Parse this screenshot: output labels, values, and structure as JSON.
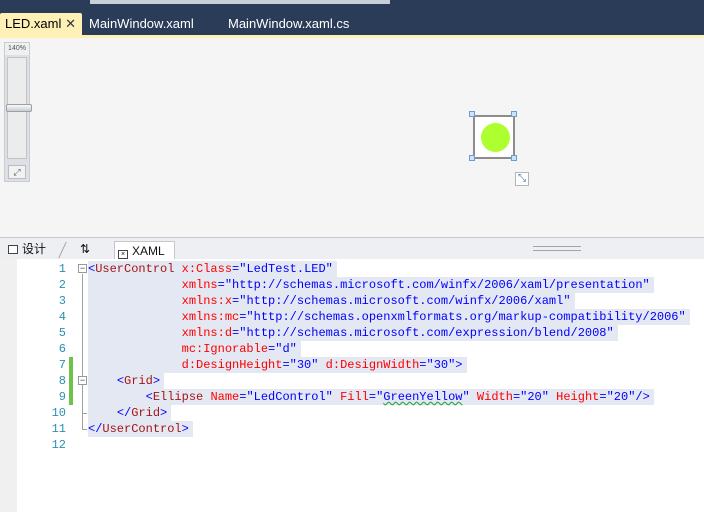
{
  "tabs": {
    "active": {
      "label": "LED.xaml",
      "close": "✕"
    },
    "others": [
      "MainWindow.xaml",
      "MainWindow.xaml.cs"
    ]
  },
  "designer": {
    "zoom_label": "140%",
    "zoom_level": 0.5,
    "ellipse_fill": "#ADFF2F",
    "fit_glyph": "⤢",
    "resize_glyph": "⤡"
  },
  "view_tabs": {
    "design": "设计",
    "swap": "⇅",
    "xaml": "XAML"
  },
  "editor": {
    "lines": [
      {
        "n": "1",
        "t": [
          [
            "p",
            "<"
          ],
          [
            "g",
            "UserControl"
          ],
          [
            "s",
            " "
          ],
          [
            "a",
            "x:Class"
          ],
          [
            "p",
            "=\""
          ],
          [
            "v",
            "LedTest.LED"
          ],
          [
            "p",
            "\""
          ]
        ]
      },
      {
        "n": "2",
        "t": [
          [
            "s",
            "             "
          ],
          [
            "a",
            "xmlns"
          ],
          [
            "p",
            "=\""
          ],
          [
            "v",
            "http://schemas.microsoft.com/winfx/2006/xaml/presentation"
          ],
          [
            "p",
            "\""
          ]
        ]
      },
      {
        "n": "3",
        "t": [
          [
            "s",
            "             "
          ],
          [
            "a",
            "xmlns:x"
          ],
          [
            "p",
            "=\""
          ],
          [
            "v",
            "http://schemas.microsoft.com/winfx/2006/xaml"
          ],
          [
            "p",
            "\""
          ]
        ]
      },
      {
        "n": "4",
        "t": [
          [
            "s",
            "             "
          ],
          [
            "a",
            "xmlns:mc"
          ],
          [
            "p",
            "=\""
          ],
          [
            "v",
            "http://schemas.openxmlformats.org/markup-compatibility/2006"
          ],
          [
            "p",
            "\""
          ]
        ]
      },
      {
        "n": "5",
        "t": [
          [
            "s",
            "             "
          ],
          [
            "a",
            "xmlns:d"
          ],
          [
            "p",
            "=\""
          ],
          [
            "v",
            "http://schemas.microsoft.com/expression/blend/2008"
          ],
          [
            "p",
            "\""
          ]
        ]
      },
      {
        "n": "6",
        "t": [
          [
            "s",
            "             "
          ],
          [
            "a",
            "mc:Ignorable"
          ],
          [
            "p",
            "=\""
          ],
          [
            "v",
            "d"
          ],
          [
            "p",
            "\""
          ]
        ]
      },
      {
        "n": "7",
        "t": [
          [
            "s",
            "             "
          ],
          [
            "a",
            "d:DesignHeight"
          ],
          [
            "p",
            "=\""
          ],
          [
            "v",
            "30"
          ],
          [
            "p",
            "\""
          ],
          [
            "s",
            " "
          ],
          [
            "a",
            "d:DesignWidth"
          ],
          [
            "p",
            "=\""
          ],
          [
            "v",
            "30"
          ],
          [
            "p",
            "\">"
          ]
        ]
      },
      {
        "n": "8",
        "t": [
          [
            "s",
            "    "
          ],
          [
            "p",
            "<"
          ],
          [
            "g",
            "Grid"
          ],
          [
            "p",
            ">"
          ]
        ]
      },
      {
        "n": "9",
        "t": [
          [
            "s",
            "        "
          ],
          [
            "p",
            "<"
          ],
          [
            "g",
            "Ellipse"
          ],
          [
            "s",
            " "
          ],
          [
            "a",
            "Name"
          ],
          [
            "p",
            "=\""
          ],
          [
            "v",
            "LedControl"
          ],
          [
            "p",
            "\""
          ],
          [
            "s",
            " "
          ],
          [
            "a",
            "Fill"
          ],
          [
            "p",
            "=\""
          ],
          [
            "w",
            "GreenYellow"
          ],
          [
            "p",
            "\""
          ],
          [
            "s",
            " "
          ],
          [
            "a",
            "Width"
          ],
          [
            "p",
            "=\""
          ],
          [
            "v",
            "20"
          ],
          [
            "p",
            "\""
          ],
          [
            "s",
            " "
          ],
          [
            "a",
            "Height"
          ],
          [
            "p",
            "=\""
          ],
          [
            "v",
            "20"
          ],
          [
            "p",
            "\"/>"
          ]
        ]
      },
      {
        "n": "10",
        "t": [
          [
            "s",
            "    "
          ],
          [
            "p",
            "</"
          ],
          [
            "g",
            "Grid"
          ],
          [
            "p",
            ">"
          ]
        ]
      },
      {
        "n": "11",
        "t": [
          [
            "p",
            "</"
          ],
          [
            "g",
            "UserControl"
          ],
          [
            "p",
            ">"
          ]
        ]
      },
      {
        "n": "12",
        "t": []
      }
    ],
    "changed_lines": [
      7,
      8,
      9
    ]
  }
}
